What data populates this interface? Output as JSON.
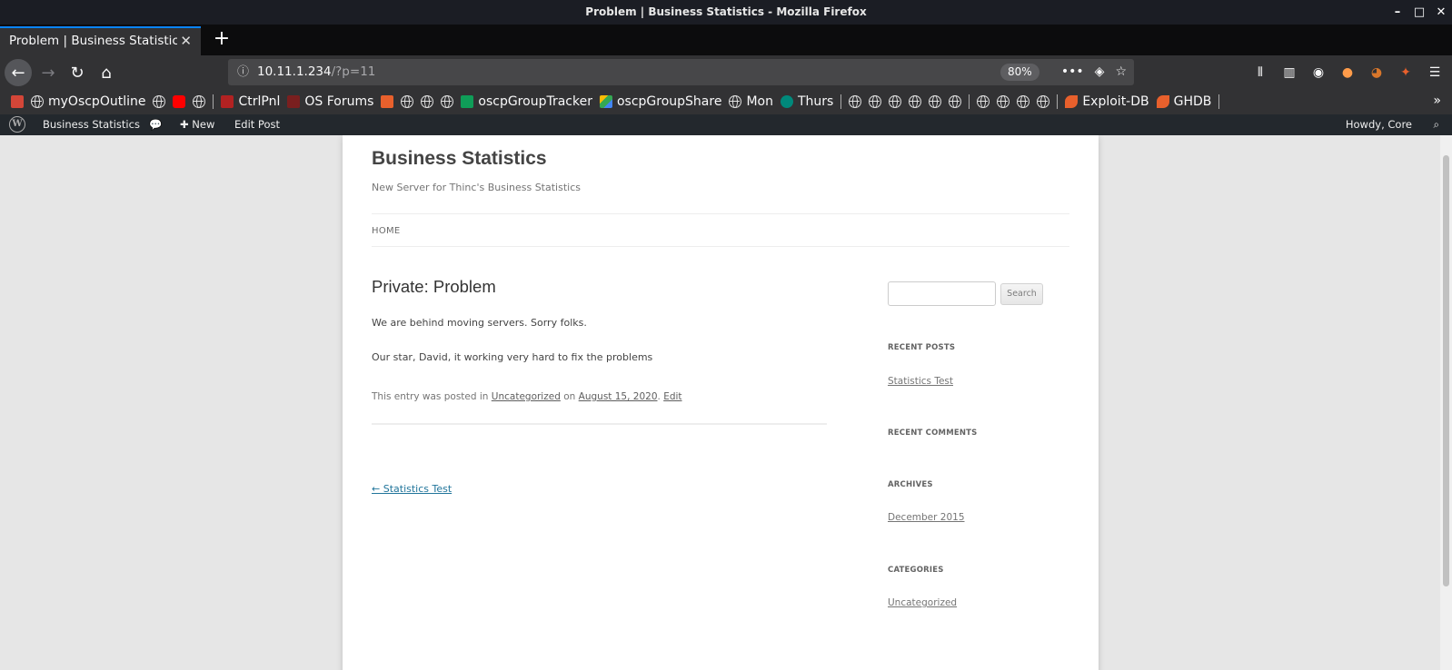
{
  "window": {
    "title": "Problem | Business Statistics - Mozilla Firefox"
  },
  "tab": {
    "title": "Problem | Business Statistics",
    "close_glyph": "✕",
    "new_tab_glyph": "+"
  },
  "url": {
    "host": "10.11.1.234",
    "path": "/?p=11",
    "zoom": "80%"
  },
  "bookmarks": {
    "items": [
      {
        "label": "myOscpOutline"
      },
      {
        "label": "CtrlPnl"
      },
      {
        "label": "OS Forums"
      },
      {
        "label": "oscpGroupTracker"
      },
      {
        "label": "oscpGroupShare"
      },
      {
        "label": "Mon"
      },
      {
        "label": "Thurs"
      },
      {
        "label": "Exploit-DB"
      },
      {
        "label": "GHDB"
      }
    ]
  },
  "wpbar": {
    "site": "Business Statistics",
    "new": "New",
    "edit": "Edit Post",
    "howdy": "Howdy, Core"
  },
  "site": {
    "title": "Business Statistics",
    "description": "New Server for Thinc's Business Statistics",
    "menu_home": "HOME"
  },
  "post": {
    "title": "Private: Problem",
    "paragraph1": "We are behind moving servers. Sorry folks.",
    "paragraph2": "Our star, David, it working very hard to fix the problems",
    "meta_prefix": "This entry was posted in",
    "meta_category": "Uncategorized",
    "meta_on": "on",
    "meta_date": "August 15, 2020",
    "meta_dot": ".",
    "meta_edit": "Edit",
    "prev_link": "← Statistics Test"
  },
  "sidebar": {
    "search_button": "Search",
    "recent_posts_title": "RECENT POSTS",
    "recent_post_1": "Statistics Test",
    "recent_comments_title": "RECENT COMMENTS",
    "archives_title": "ARCHIVES",
    "archive_1": "December 2015",
    "categories_title": "CATEGORIES",
    "category_1": "Uncategorized"
  },
  "colors": {
    "titlebar": "#1b1d24",
    "tab_active": "#323234",
    "tab_accent": "#0a84ff",
    "wp_admin_bar": "#23282d",
    "link_blue": "#21759b"
  }
}
